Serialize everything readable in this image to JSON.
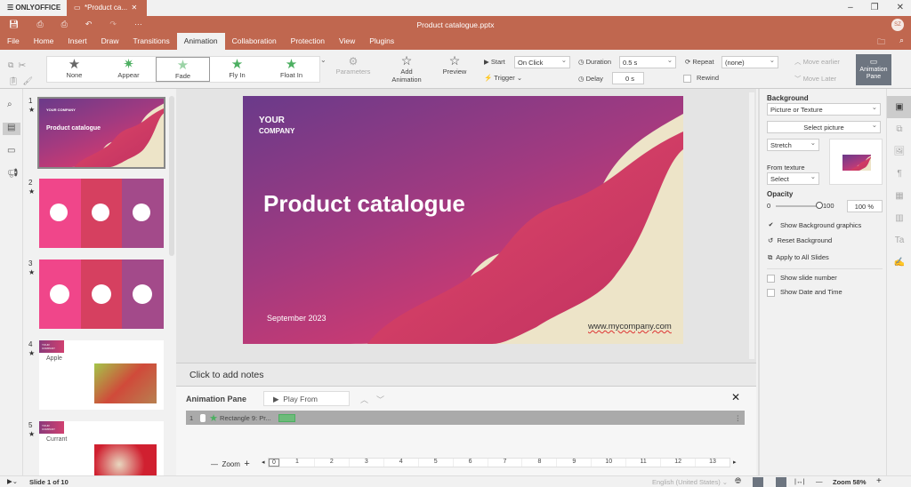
{
  "app": {
    "brand": "ONLYOFFICE",
    "tab_title": "*Product ca...",
    "doc_title": "Product catalogue.pptx",
    "user_initials": "SZ"
  },
  "menu": [
    "File",
    "Home",
    "Insert",
    "Draw",
    "Transitions",
    "Animation",
    "Collaboration",
    "Protection",
    "View",
    "Plugins"
  ],
  "menu_active": "Animation",
  "toolbar": {
    "effects": [
      "None",
      "Appear",
      "Fade",
      "Fly In",
      "Float In"
    ],
    "selected_effect": "Fade",
    "parameters": "Parameters",
    "add_animation": "Add Animation",
    "preview": "Preview",
    "start_label": "Start",
    "start_value": "On Click",
    "trigger": "Trigger",
    "duration_label": "Duration",
    "duration_value": "0.5 s",
    "delay_label": "Delay",
    "delay_value": "0 s",
    "repeat_label": "Repeat",
    "repeat_value": "(none)",
    "rewind": "Rewind",
    "move_earlier": "Move earlier",
    "move_later": "Move Later",
    "animation_pane": "Animation Pane"
  },
  "thumbnails": [
    {
      "num": "1",
      "title": "Product catalogue",
      "company": "YOUR COMPANY"
    },
    {
      "num": "2"
    },
    {
      "num": "3"
    },
    {
      "num": "4",
      "title": "Apple",
      "company": "YOUR COMPANY"
    },
    {
      "num": "5",
      "title": "Currant",
      "company": "YOUR COMPANY"
    }
  ],
  "slide": {
    "company_line1": "YOUR",
    "company_line2": "COMPANY",
    "title": "Product catalogue",
    "date": "September 2023",
    "url": "www.mycompany.com",
    "anim_tag": "1"
  },
  "notes_placeholder": "Click to add notes",
  "anim_pane": {
    "title": "Animation Pane",
    "play_from": "Play From",
    "item_num": "1",
    "item_name": "Rectangle 9: Pr...",
    "zoom_label": "Zoom",
    "timeline": [
      "0",
      "1",
      "2",
      "3",
      "4",
      "5",
      "6",
      "7",
      "8",
      "9",
      "10",
      "11",
      "12",
      "13"
    ]
  },
  "right_panel": {
    "background_label": "Background",
    "fill_type": "Picture or Texture",
    "select_picture": "Select picture",
    "stretch": "Stretch",
    "from_texture": "From texture",
    "texture_select": "Select",
    "opacity_label": "Opacity",
    "opacity_min": "0",
    "opacity_max": "100",
    "opacity_value": "100 %",
    "opacity_fraction": 1.0,
    "show_bg_graphics": "Show Background graphics",
    "reset_bg": "Reset Background",
    "apply_all": "Apply to All Slides",
    "show_slide_number": "Show slide number",
    "show_date_time": "Show Date and Time"
  },
  "status": {
    "slide_info": "Slide 1 of 10",
    "language": "English (United States)",
    "zoom": "Zoom 58%"
  },
  "colors": {
    "brand": "#c0674f",
    "star_green": "#4caf61"
  }
}
